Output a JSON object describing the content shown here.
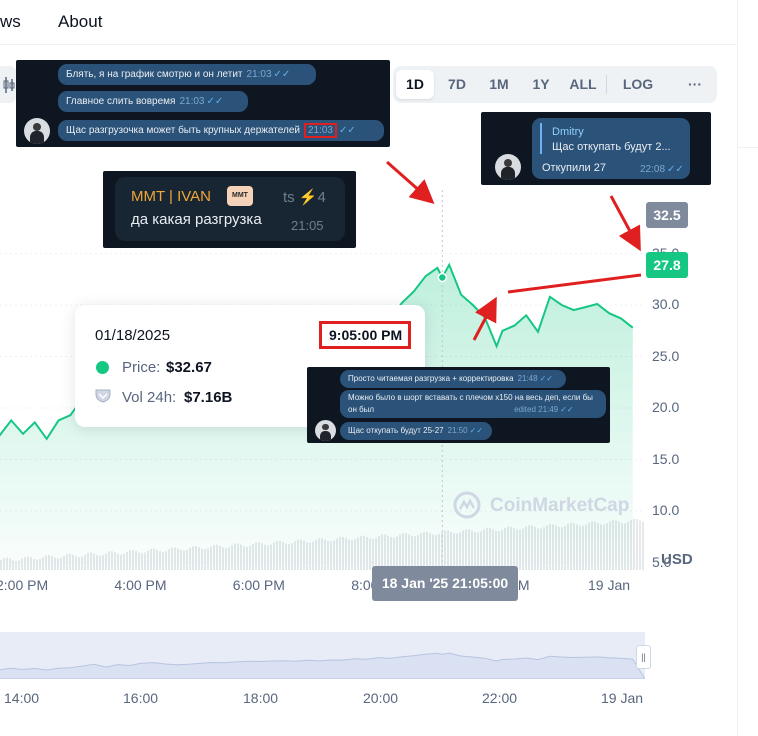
{
  "nav": {
    "news": "ws",
    "about": "About"
  },
  "toolbar": {
    "btn_1d": "1D",
    "btn_7d": "7D",
    "btn_1m": "1M",
    "btn_1y": "1Y",
    "btn_all": "ALL",
    "btn_log": "LOG",
    "btn_more": "···"
  },
  "tg1": {
    "messages": [
      {
        "text": "Блять, я на график смотрю и он летит",
        "time": "21:03"
      },
      {
        "text": "Главное слить вовремя",
        "time": "21:03"
      },
      {
        "text": "Щас разгрузочка может быть крупных держателей",
        "time": "21:03"
      }
    ]
  },
  "tg2": {
    "author": "MMT | IVAN",
    "badge": "MMT",
    "extra": "ts ⚡4",
    "text": "да какая разгрузка",
    "time": "21:05"
  },
  "tg3": {
    "reply_author": "Dmitry",
    "reply_text": "Щас откупать будут 2...",
    "text": "Откупили 27",
    "time": "22:08"
  },
  "tg4": {
    "messages": [
      {
        "text": "Просто читаемая разгрузка + корректировка",
        "time": "21:48"
      },
      {
        "text": "Можно было в шорт вставать с плечом х150 на весь деп, если бы",
        "text2": "он был",
        "time": "edited 21:49"
      },
      {
        "text": "Щас откупать будут 25-27",
        "time": "21:50"
      }
    ]
  },
  "tooltip": {
    "date": "01/18/2025",
    "time": "9:05:00 PM",
    "price_label": "Price:",
    "price_value": "$32.67",
    "vol_label": "Vol 24h:",
    "vol_value": "$7.16B"
  },
  "crosshair_label": "18 Jan '25 21:05:00",
  "watermark": "CoinMarketCap",
  "currency": "USD",
  "price_tags": {
    "high": "32.5",
    "current": "27.8"
  },
  "nav_labels": [
    "14:00",
    "16:00",
    "18:00",
    "20:00",
    "22:00",
    "19 Jan"
  ],
  "colors": {
    "up": "#16c784",
    "grey_tag": "#808a9d",
    "highlight": "#e02020",
    "tg_bg": "#0e1621"
  },
  "chart_data": {
    "type": "area",
    "title": "",
    "ylabel": "",
    "xlabel": "",
    "currency": "USD",
    "ylim": [
      0,
      38
    ],
    "yticks": [
      5.0,
      10.0,
      15.0,
      20.0,
      25.0,
      30.0,
      35.0
    ],
    "ytick_labels": [
      "5.0",
      "10.0",
      "15.0",
      "20.0",
      "25.0",
      "30.0",
      "35.0"
    ],
    "xtick_labels": [
      "2:00 PM",
      "4:00 PM",
      "6:00 PM",
      "8:00 PM",
      "10:00 PM",
      "19 Jan"
    ],
    "xtick_hours": [
      14,
      16,
      18,
      20,
      22,
      24
    ],
    "x_hours": [
      13.2,
      13.4,
      13.6,
      13.8,
      14.0,
      14.2,
      14.4,
      14.6,
      14.8,
      15.0,
      15.2,
      15.4,
      15.6,
      15.8,
      16.0,
      16.2,
      16.4,
      16.6,
      16.8,
      17.0,
      17.2,
      17.4,
      17.6,
      17.8,
      18.0,
      18.2,
      18.4,
      18.6,
      18.8,
      19.0,
      19.2,
      19.4,
      19.6,
      19.8,
      20.0,
      20.2,
      20.4,
      20.6,
      20.8,
      21.0,
      21.083,
      21.2,
      21.4,
      21.6,
      21.8,
      22.0,
      22.1,
      22.3,
      22.5,
      22.7,
      22.9,
      23.1,
      23.3,
      23.5,
      23.7,
      23.9,
      24.1,
      24.3
    ],
    "price": [
      16.8,
      18.5,
      17.3,
      18.8,
      17.5,
      18.6,
      17.0,
      18.8,
      19.3,
      20.9,
      22.7,
      20.0,
      22.4,
      21.5,
      23.8,
      24.4,
      23.0,
      22.3,
      22.8,
      23.7,
      24.5,
      24.2,
      25.1,
      25.7,
      25.5,
      26.0,
      26.3,
      25.8,
      26.7,
      26.1,
      27.0,
      26.9,
      28.2,
      27.8,
      29.4,
      28.6,
      30.2,
      31.3,
      32.8,
      33.6,
      32.67,
      33.9,
      31.0,
      30.0,
      28.8,
      26.0,
      27.5,
      28.0,
      29.0,
      27.4,
      30.8,
      30.0,
      29.5,
      29.8,
      30.1,
      29.2,
      28.7,
      27.8
    ],
    "volume_note": "24h volume bars shown below price area",
    "crosshair": {
      "time": "18 Jan '25 21:05:00",
      "price": 32.67,
      "vol_24h": "$7.16B"
    },
    "price_tags": {
      "high": 32.5,
      "current": 27.8
    }
  }
}
